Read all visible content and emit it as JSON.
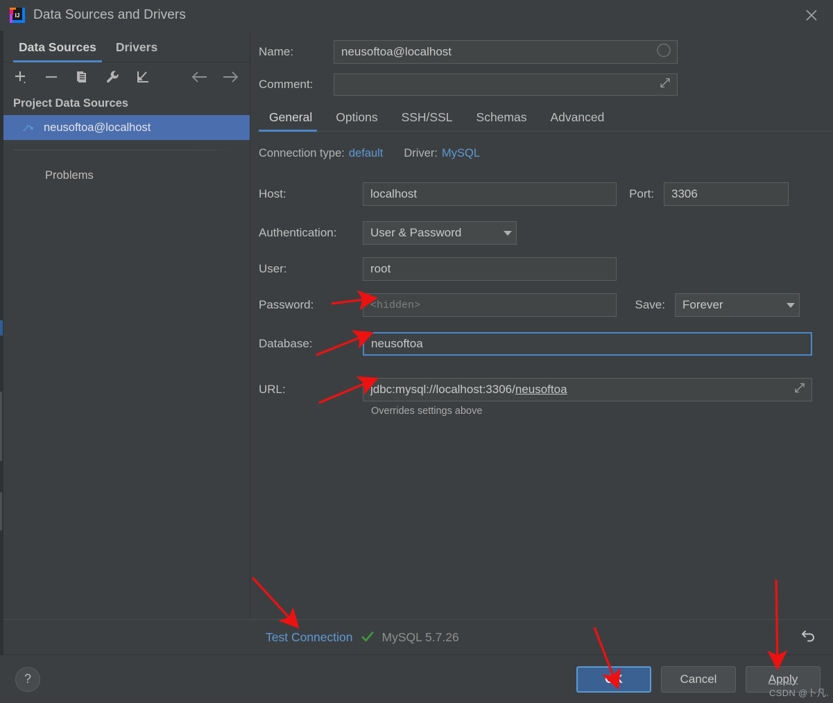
{
  "window": {
    "title": "Data Sources and Drivers",
    "logo_icon": "intellij-idea-logo",
    "close_icon": "close-icon"
  },
  "sidebar": {
    "tabs": [
      {
        "label": "Data Sources",
        "active": true
      },
      {
        "label": "Drivers",
        "active": false
      }
    ],
    "toolbar": [
      {
        "icon": "add-icon",
        "name": "add-data-source-button"
      },
      {
        "icon": "remove-icon",
        "name": "remove-data-source-button"
      },
      {
        "icon": "duplicate-icon",
        "name": "duplicate-data-source-button"
      },
      {
        "icon": "wrench-icon",
        "name": "properties-button"
      },
      {
        "icon": "import-icon",
        "name": "import-data-source-button"
      }
    ],
    "nav": [
      {
        "icon": "arrow-left-icon",
        "name": "navigate-back-button"
      },
      {
        "icon": "arrow-right-icon",
        "name": "navigate-forward-button"
      }
    ],
    "group_header": "Project Data Sources",
    "items": [
      {
        "label": "neusoftoa@localhost",
        "icon": "mysql-dolphin-icon",
        "selected": true
      }
    ],
    "problems_label": "Problems"
  },
  "details": {
    "name_label": "Name:",
    "name_value": "neusoftoa@localhost",
    "name_status_icon": "circle-icon",
    "comment_label": "Comment:",
    "comment_value": "",
    "comment_placeholder": "",
    "comment_expand_icon": "expand-icon",
    "tabs": [
      {
        "label": "General",
        "active": true
      },
      {
        "label": "Options",
        "active": false
      },
      {
        "label": "SSH/SSL",
        "active": false
      },
      {
        "label": "Schemas",
        "active": false
      },
      {
        "label": "Advanced",
        "active": false
      }
    ],
    "connection_type_label": "Connection type:",
    "connection_type_value": "default",
    "driver_label": "Driver:",
    "driver_value": "MySQL",
    "host_label": "Host:",
    "host_value": "localhost",
    "port_label": "Port:",
    "port_value": "3306",
    "auth_label": "Authentication:",
    "auth_value": "User & Password",
    "user_label": "User:",
    "user_value": "root",
    "password_label": "Password:",
    "password_placeholder": "<hidden>",
    "save_label": "Save:",
    "save_value": "Forever",
    "database_label": "Database:",
    "database_value": "neusoftoa",
    "url_label": "URL:",
    "url_prefix": "jdbc:mysql://localhost:3306/",
    "url_db": "neusoftoa",
    "url_expand_icon": "expand-icon",
    "url_hint": "Overrides settings above"
  },
  "status": {
    "test_connection_label": "Test Connection",
    "success_icon": "checkmark-icon",
    "version_text": "MySQL 5.7.26",
    "revert_icon": "revert-icon"
  },
  "footer": {
    "help_label": "?",
    "help_icon": "help-icon",
    "ok_label": "OK",
    "cancel_label": "Cancel",
    "apply_label": "Apply"
  },
  "watermark": "CSDN @卜凡.",
  "colors": {
    "background": "#3c3f41",
    "field": "#45494a",
    "selection": "#4b6eaf",
    "accent": "#4a88c7",
    "link": "#5c9ad6",
    "success": "#499c54",
    "annotation": "#ee1111"
  }
}
